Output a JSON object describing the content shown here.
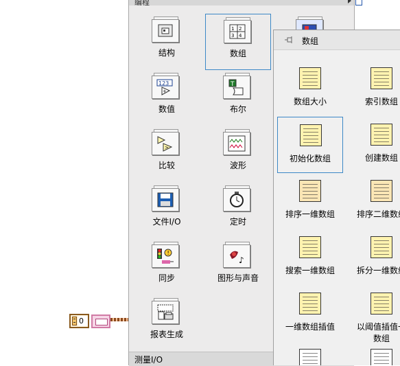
{
  "palette": {
    "header_label": "编程",
    "footer_label": "测量I/O",
    "items": [
      {
        "label": "结构",
        "icon": "structures-icon"
      },
      {
        "label": "数组",
        "icon": "array-icon",
        "selected": true
      },
      {
        "label": "数值",
        "icon": "numeric-icon"
      },
      {
        "label": "布尔",
        "icon": "boolean-icon"
      },
      {
        "label": "比较",
        "icon": "comparison-icon"
      },
      {
        "label": "波形",
        "icon": "waveform-icon"
      },
      {
        "label": "文件I/O",
        "icon": "file-io-icon"
      },
      {
        "label": "定时",
        "icon": "timing-icon"
      },
      {
        "label": "同步",
        "icon": "synchronization-icon"
      },
      {
        "label": "图形与声音",
        "icon": "graphics-sound-icon"
      },
      {
        "label": "报表生成",
        "icon": "report-generation-icon"
      }
    ]
  },
  "subpalette": {
    "title": "数组",
    "items": [
      {
        "label": "数组大小"
      },
      {
        "label": "索引数组"
      },
      {
        "label": "初始化数组",
        "selected": true
      },
      {
        "label": "创建数组"
      },
      {
        "label": "排序一维数组"
      },
      {
        "label": "排序二维数组"
      },
      {
        "label": "搜索一维数组"
      },
      {
        "label": "拆分一维数组"
      },
      {
        "label": "一维数组插值"
      },
      {
        "label": "以阈值插值一\n数组"
      }
    ]
  },
  "canvas": {
    "constant_value": "0"
  },
  "colors": {
    "selection_border": "#3b87c6",
    "constant_border": "#8a5a1e",
    "array_wire": "#d07aa5"
  }
}
